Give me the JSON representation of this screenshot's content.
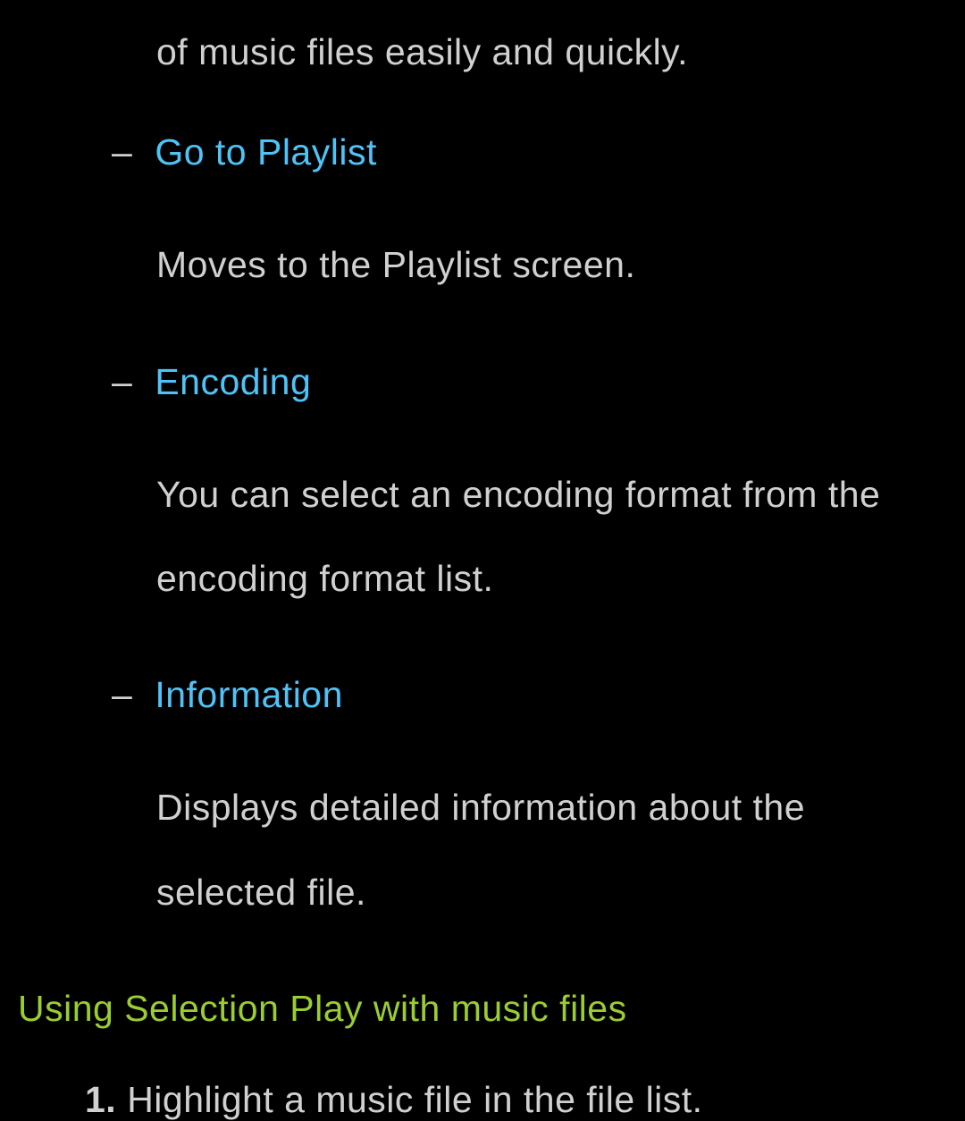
{
  "intro_tail": "of music files easily and quickly.",
  "items": [
    {
      "dash": "–",
      "title": "Go to Playlist",
      "body": "Moves to the Playlist screen."
    },
    {
      "dash": "–",
      "title": "Encoding",
      "body": "You can select an encoding format from the encoding format list."
    },
    {
      "dash": "–",
      "title": "Information",
      "body": "Displays detailed information about the selected file."
    }
  ],
  "section_heading": "Using Selection Play with music files",
  "ordered": {
    "num": "1.",
    "text": "Highlight a music file in the file list."
  }
}
